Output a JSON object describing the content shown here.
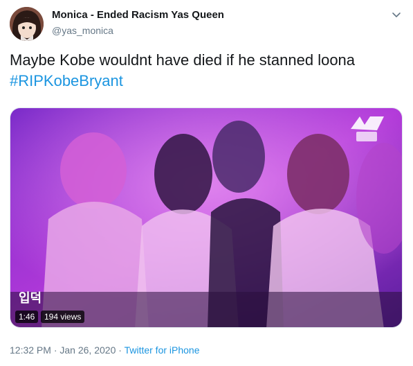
{
  "author": {
    "display_name": "Monica - Ended Racism Yas Queen",
    "handle": "@yas_monica"
  },
  "tweet": {
    "text": "Maybe Kobe wouldnt have died if he stanned loona",
    "hashtag": "#RIPKobeBryant"
  },
  "media": {
    "duration": "1:46",
    "views": "194 views",
    "watermark_caption": "입덕"
  },
  "footer": {
    "time": "12:32 PM",
    "separator1": " · ",
    "date": "Jan 26, 2020",
    "separator2": " · ",
    "source": "Twitter for iPhone"
  },
  "colors": {
    "accent": "#1b95e0",
    "secondary_text": "#657786",
    "media_tint": "#9b2fd6"
  },
  "icons": {
    "menu": "chevron-down-icon"
  }
}
